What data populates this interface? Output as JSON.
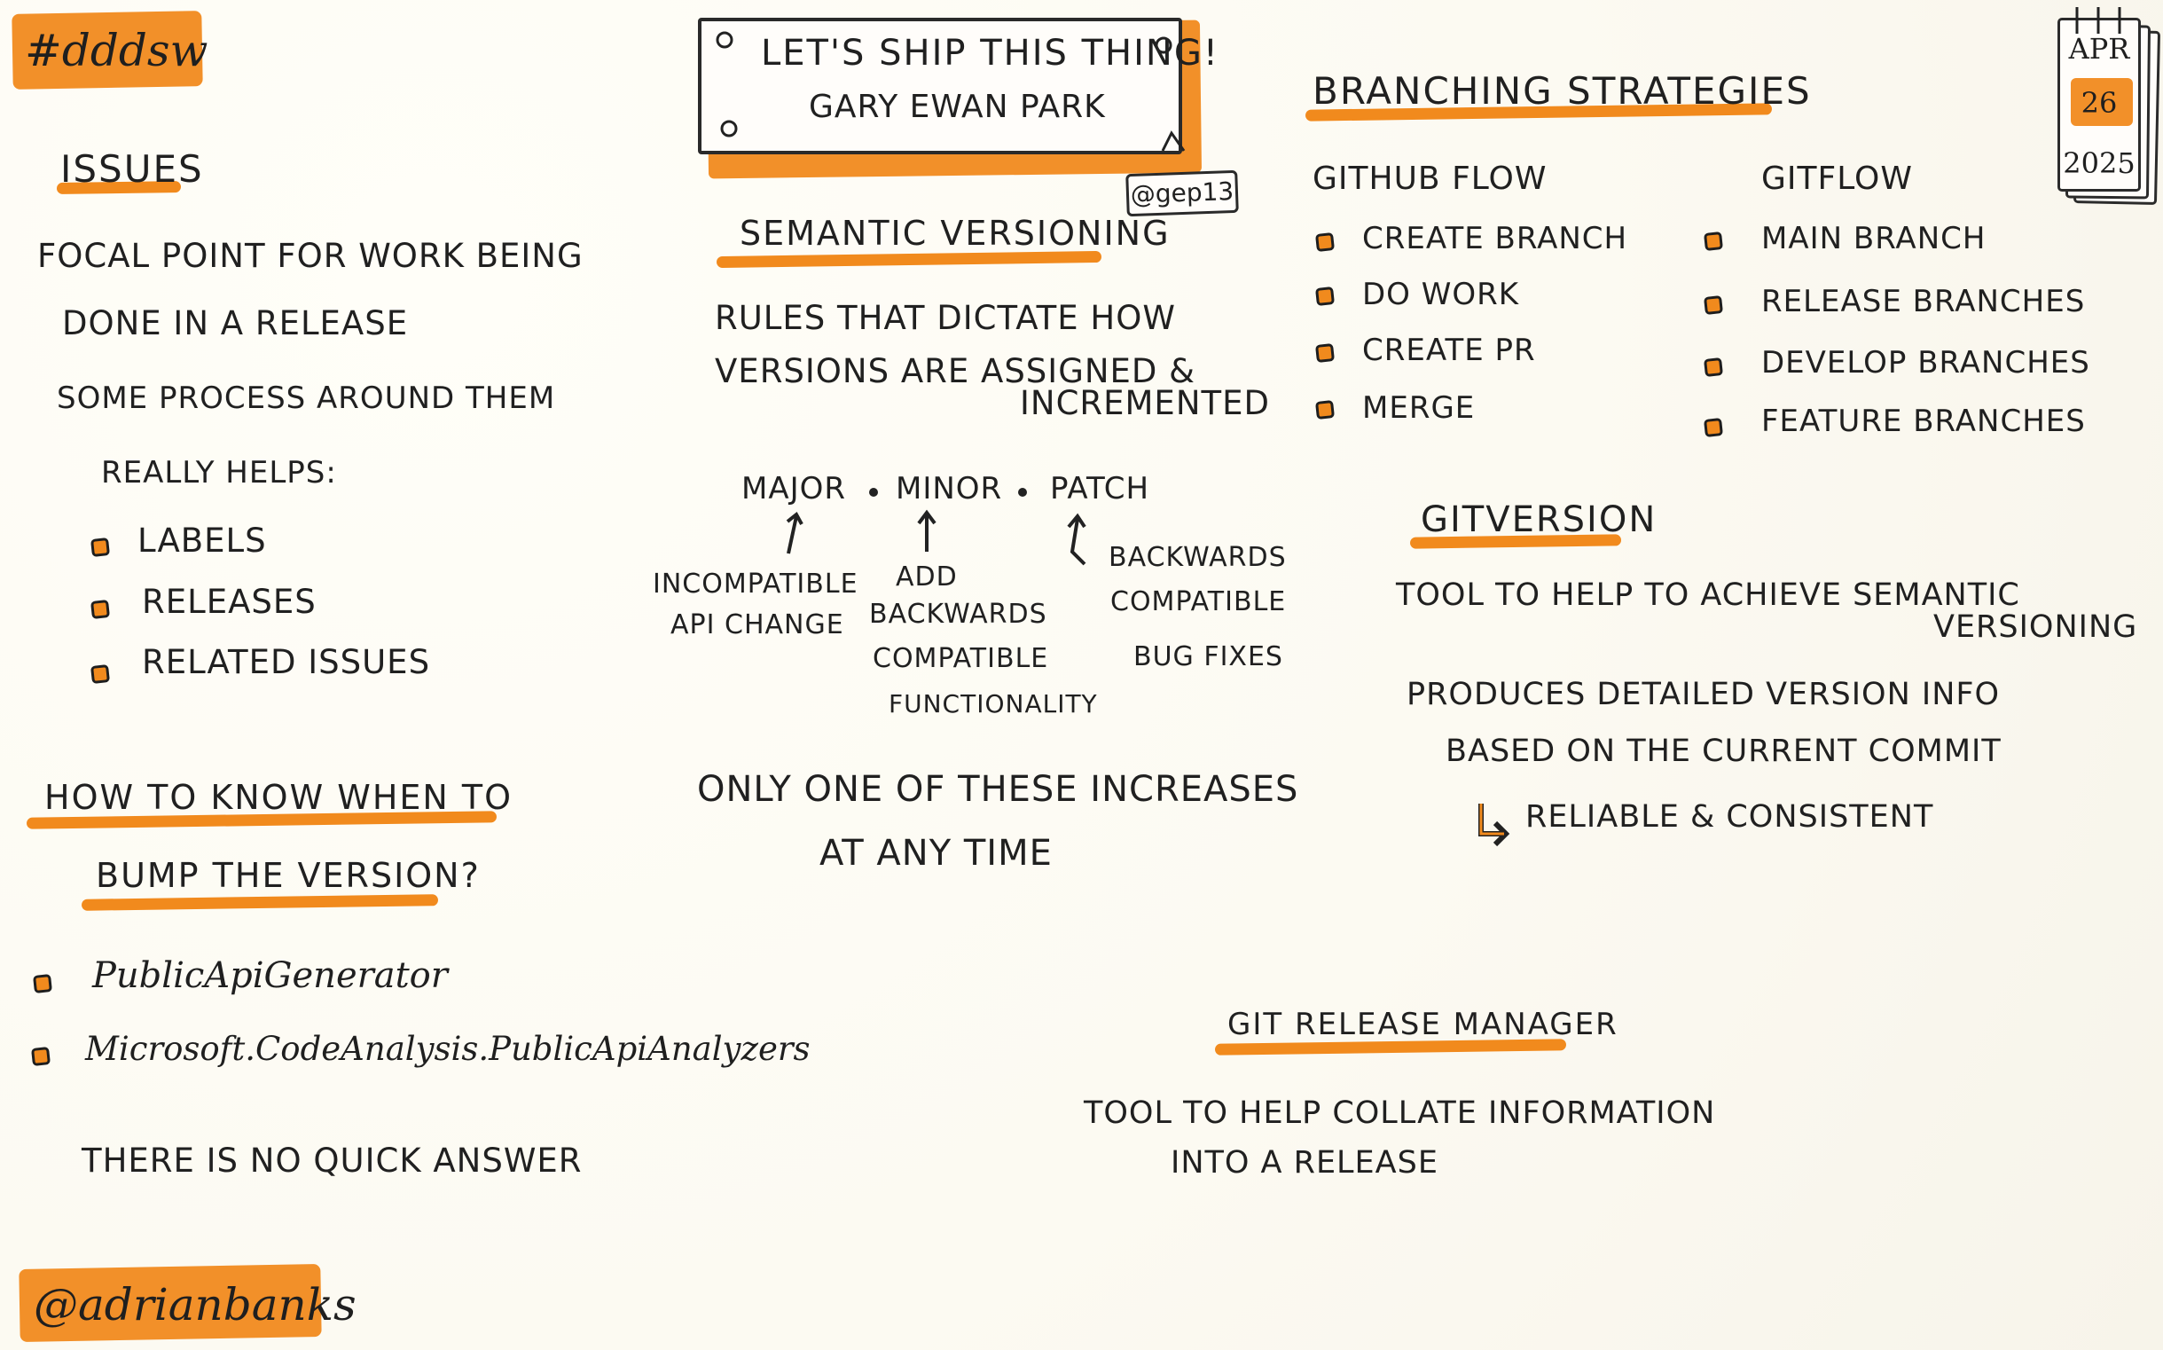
{
  "header": {
    "hashtag": "#dddsw",
    "talk_title": "LET'S SHIP THIS THING!",
    "speaker": "GARY EWAN PARK",
    "handle_tag": "@gep13",
    "date_month": "APR",
    "date_day": "26",
    "date_year": "2025"
  },
  "issues": {
    "title": "ISSUES",
    "line1": "FOCAL POINT FOR WORK BEING",
    "line2": "DONE IN A RELEASE",
    "line3": "SOME PROCESS AROUND THEM",
    "line4": "REALLY HELPS:",
    "items": [
      "LABELS",
      "RELEASES",
      "RELATED ISSUES"
    ]
  },
  "bump": {
    "title_line1": "HOW TO KNOW WHEN TO",
    "title_line2": "BUMP THE VERSION?",
    "items": [
      "PublicApiGenerator",
      "Microsoft.CodeAnalysis.PublicApiAnalyzers"
    ],
    "note": "THERE IS NO QUICK ANSWER"
  },
  "semantic": {
    "title": "SEMANTIC VERSIONING",
    "line1": "RULES THAT DICTATE HOW",
    "line2": "VERSIONS ARE ASSIGNED &",
    "line3": "INCREMENTED",
    "major": "MAJOR",
    "minor": "MINOR",
    "patch": "PATCH",
    "major_desc_1": "INCOMPATIBLE",
    "major_desc_2": "API CHANGE",
    "minor_desc_1": "ADD",
    "minor_desc_2": "BACKWARDS",
    "minor_desc_3": "COMPATIBLE",
    "minor_desc_4": "FUNCTIONALITY",
    "patch_desc_1": "BACKWARDS",
    "patch_desc_2": "COMPATIBLE",
    "patch_desc_3": "BUG FIXES",
    "footer_1": "ONLY ONE OF THESE INCREASES",
    "footer_2": "AT ANY TIME"
  },
  "branching": {
    "title": "BRANCHING STRATEGIES",
    "github_flow_title": "GITHUB FLOW",
    "github_flow_items": [
      "CREATE BRANCH",
      "DO WORK",
      "CREATE PR",
      "MERGE"
    ],
    "gitflow_title": "GITFLOW",
    "gitflow_items": [
      "MAIN BRANCH",
      "RELEASE BRANCHES",
      "DEVELOP BRANCHES",
      "FEATURE BRANCHES"
    ]
  },
  "gitversion": {
    "title": "GITVERSION",
    "line1": "TOOL TO HELP TO ACHIEVE SEMANTIC",
    "line2": "VERSIONING",
    "line3": "PRODUCES DETAILED VERSION INFO",
    "line4": "BASED ON THE CURRENT COMMIT",
    "line5": "RELIABLE & CONSISTENT"
  },
  "release_manager": {
    "title": "GIT RELEASE MANAGER",
    "line1": "TOOL TO HELP COLLATE INFORMATION",
    "line2": "INTO A RELEASE"
  },
  "footer": {
    "author": "@adrianbanks"
  }
}
